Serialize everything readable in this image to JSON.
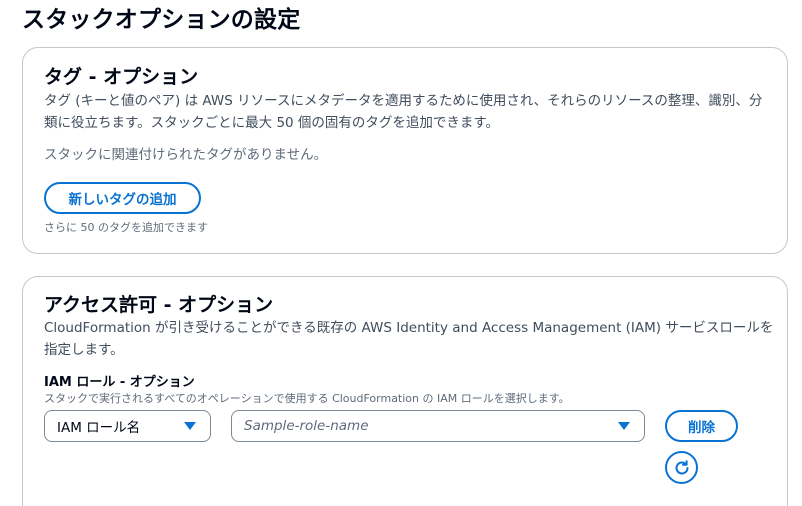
{
  "page": {
    "title": "スタックオプションの設定"
  },
  "tags_section": {
    "heading": "タグ - オプション",
    "description": "タグ (キーと値のペア) は AWS リソースにメタデータを適用するために使用され、それらのリソースの整理、識別、分類に役立ちます。スタックごとに最大 50 個の固有のタグを追加できます。",
    "empty_message": "スタックに関連付けられたタグがありません。",
    "add_button_label": "新しいタグの追加",
    "remaining_hint": "さらに 50 のタグを追加できます"
  },
  "permissions_section": {
    "heading": "アクセス許可 - オプション",
    "description": "CloudFormation が引き受けることができる既存の AWS Identity and Access Management (IAM) サービスロールを指定します。",
    "iam_role_label": "IAM ロール - オプション",
    "iam_role_hint": "スタックで実行されるすべてのオペレーションで使用する CloudFormation の IAM ロールを選択します。",
    "role_type_select_value": "IAM ロール名",
    "role_name_placeholder": "Sample-role-name",
    "remove_button_label": "削除"
  },
  "icons": {
    "dropdown": "caret-down-icon",
    "refresh": "refresh-icon"
  },
  "colors": {
    "accent": "#0972d3",
    "border": "#c6c6cd",
    "text": "#000716",
    "muted_text": "#5f6b7a"
  }
}
